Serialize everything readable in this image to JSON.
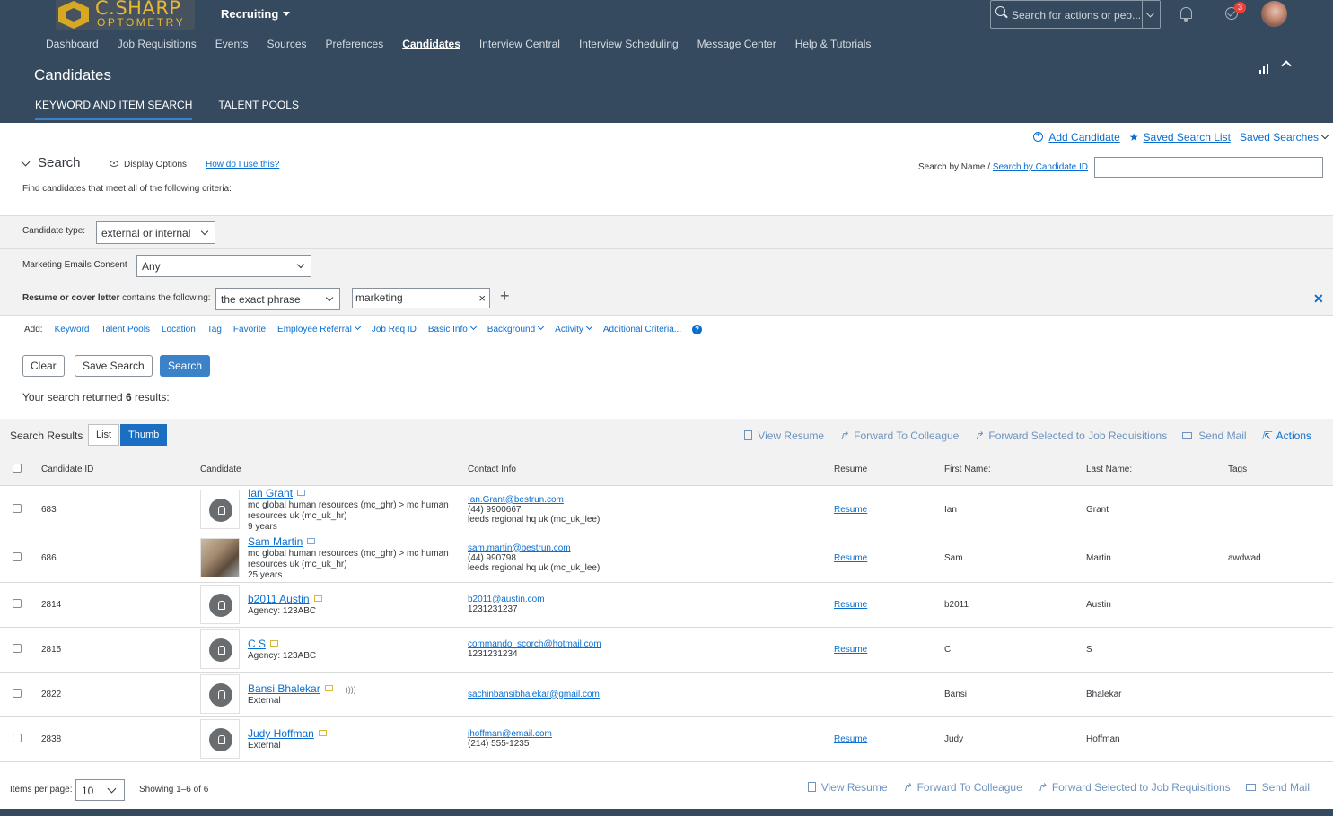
{
  "brand": {
    "line1": "C.SHARP",
    "line2": "OPTOMETRY",
    "accent": "#e9b830",
    "shell_color": "#354a5f"
  },
  "app_menu": "Recruiting",
  "global_search": {
    "placeholder": "Search for actions or peo..."
  },
  "notifications": {
    "badge": "3"
  },
  "nav": [
    "Dashboard",
    "Job Requisitions",
    "Events",
    "Sources",
    "Preferences",
    "Candidates",
    "Interview Central",
    "Interview Scheduling",
    "Message Center",
    "Help & Tutorials"
  ],
  "nav_active": "Candidates",
  "page_title": "Candidates",
  "tabs": [
    "KEYWORD AND ITEM SEARCH",
    "TALENT POOLS"
  ],
  "top_links": {
    "add_candidate": "Add Candidate",
    "saved_search_list": "Saved Search List",
    "saved_searches": "Saved Searches"
  },
  "search_panel": {
    "heading": "Search",
    "display_options": "Display Options",
    "how_do": "How do I use this?",
    "find_text": "Find candidates that meet all of the following criteria:",
    "search_by_name": "Search by Name /",
    "search_by_id": "Search by Candidate ID",
    "name_value": ""
  },
  "criteria": {
    "candidate_type_label": "Candidate type:",
    "candidate_type_value": "external or internal",
    "marketing_label": "Marketing Emails Consent",
    "marketing_value": "Any",
    "resume_label_bold": "Resume or cover letter",
    "resume_label_rest": " contains the following:",
    "match_value": "the exact phrase",
    "keyword": "marketing"
  },
  "add_row": {
    "label": "Add:",
    "items": [
      "Keyword",
      "Talent Pools",
      "Location",
      "Tag",
      "Favorite",
      "Employee Referral",
      "Job Req ID",
      "Basic Info",
      "Background",
      "Activity",
      "Additional Criteria..."
    ]
  },
  "buttons": {
    "clear": "Clear",
    "save_search": "Save Search",
    "search": "Search"
  },
  "results_summary": {
    "pre": "Your search returned ",
    "count": "6",
    "post": " results:"
  },
  "results_bar": {
    "title": "Search Results",
    "list": "List",
    "thumb": "Thumb",
    "view_resume": "View Resume",
    "forward": "Forward To Colleague",
    "forward_req": "Forward Selected to Job Requisitions",
    "send_mail": "Send Mail",
    "actions": "Actions"
  },
  "columns": [
    "Candidate ID",
    "Candidate",
    "Contact Info",
    "Resume",
    "First Name:",
    "Last Name:",
    "Tags"
  ],
  "rows": [
    {
      "id": "683",
      "name": "Ian Grant",
      "d1": "mc global human resources (mc_ghr) > mc human",
      "d2": "resources uk (mc_uk_hr)",
      "d3": "9 years",
      "email": "Ian.Grant@bestrun.com",
      "phone": "(44) 9900667",
      "loc": "leeds regional hq uk (mc_uk_lee)",
      "resume": "Resume",
      "first": "Ian",
      "last": "Grant",
      "tags": ""
    },
    {
      "id": "686",
      "name": "Sam Martin",
      "d1": "mc global human resources (mc_ghr) > mc human",
      "d2": "resources uk (mc_uk_hr)",
      "d3": "25 years",
      "email": "sam.martin@bestrun.com",
      "phone": "(44) 990798",
      "loc": "leeds regional hq uk (mc_uk_lee)",
      "resume": "Resume",
      "first": "Sam",
      "last": "Martin",
      "tags": "awdwad"
    },
    {
      "id": "2814",
      "name": "b2011 Austin",
      "d1": "Agency: 123ABC",
      "email": "b2011@austin.com",
      "phone": "1231231237",
      "resume": "Resume",
      "first": "b2011",
      "last": "Austin",
      "tags": ""
    },
    {
      "id": "2815",
      "name": "C S",
      "d1": "Agency: 123ABC",
      "email": "commando_scorch@hotmail.com",
      "phone": "1231231234",
      "resume": "Resume",
      "first": "C",
      "last": "S",
      "tags": ""
    },
    {
      "id": "2822",
      "name": "Bansi Bhalekar",
      "d1": "External",
      "email": "sachinbansibhalekar@gmail.com",
      "resume": "",
      "first": "Bansi",
      "last": "Bhalekar",
      "tags": ""
    },
    {
      "id": "2838",
      "name": "Judy Hoffman",
      "d1": "External",
      "email": "jhoffman@email.com",
      "phone": "(214) 555-1235",
      "resume": "Resume",
      "first": "Judy",
      "last": "Hoffman",
      "tags": ""
    }
  ],
  "footer": {
    "items_per_page_label": "Items per page:",
    "items_per_page": "10",
    "showing": "Showing 1–6 of 6"
  }
}
